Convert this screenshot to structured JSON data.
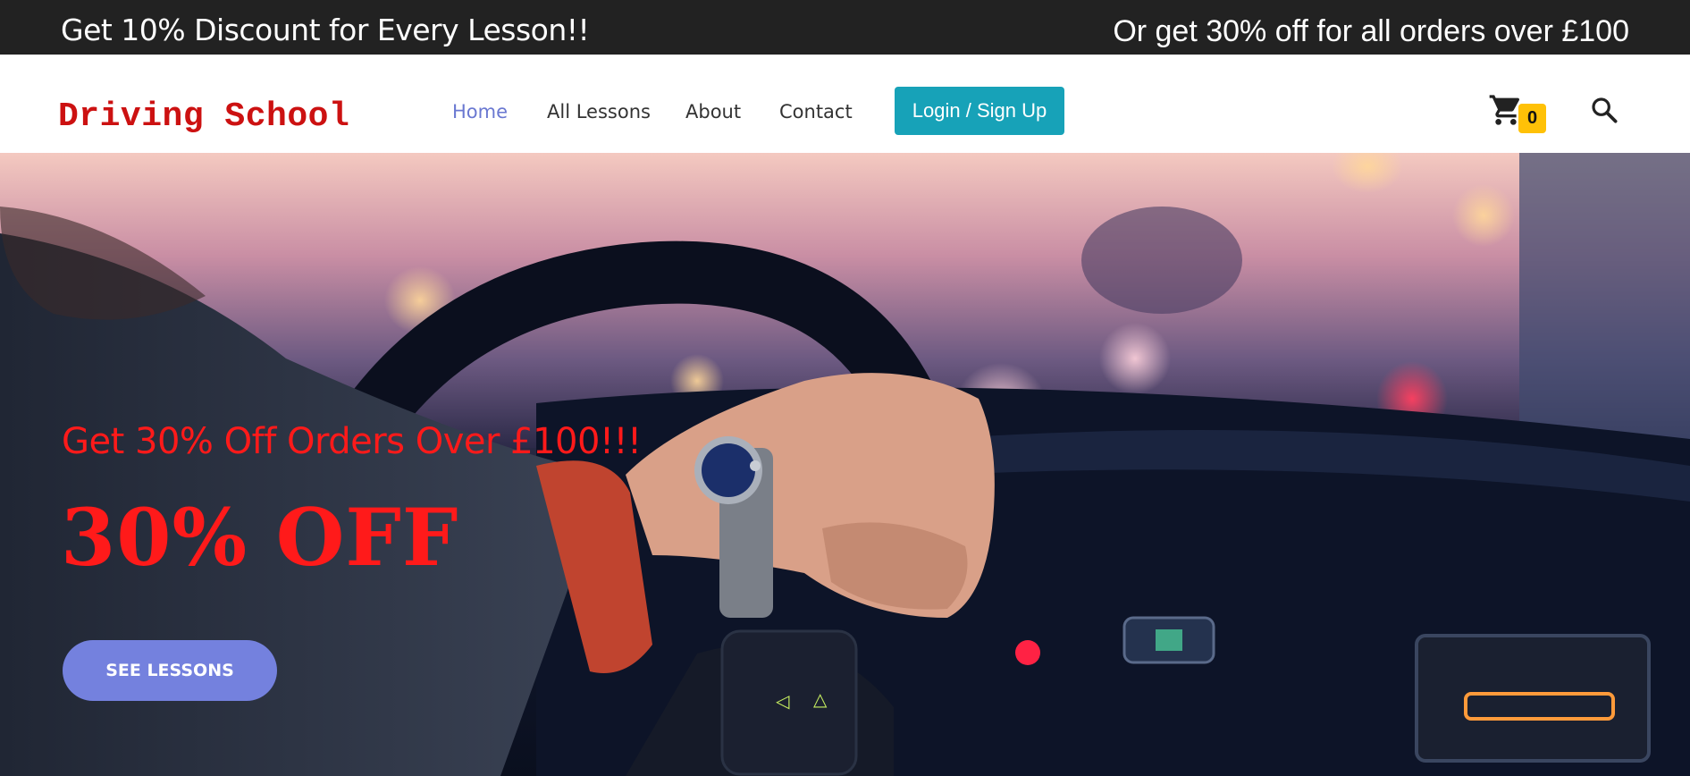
{
  "promo": {
    "left_text": "Get 10% Discount for Every Lesson!!",
    "right_text": "Or get 30% off for all orders over £100"
  },
  "header": {
    "logo": "Driving School",
    "nav": [
      {
        "label": "Home",
        "active": true
      },
      {
        "label": "All Lessons",
        "active": false
      },
      {
        "label": "About",
        "active": false
      },
      {
        "label": "Contact",
        "active": false
      }
    ],
    "login_label": "Login / Sign Up",
    "cart_count": "0",
    "cart_icon": "shopping-cart-icon",
    "search_icon": "search-icon"
  },
  "hero": {
    "subtitle": "Get 30% Off Orders Over £100!!!",
    "title": "30% OFF",
    "button_label": "SEE LESSONS"
  },
  "colors": {
    "promo_bg": "#222222",
    "logo": "#cc1111",
    "nav_active": "#6a78d1",
    "login_bg": "#17a2b8",
    "badge": "#ffc107",
    "hero_text": "#ff1a1a",
    "hero_button": "#7481de"
  }
}
